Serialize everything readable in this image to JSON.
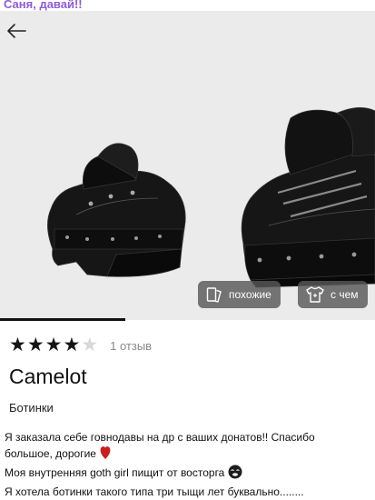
{
  "caption": "Саня, давай!!",
  "icons": {
    "back": "arrow-left-icon",
    "similar": "cards-icon",
    "with": "shirt-icon",
    "heart": "red-heart-emoji",
    "face": "kiss-face-emoji"
  },
  "product": {
    "rating_value": 4,
    "rating_max": 5,
    "reviews_label": "1 отзыв",
    "title": "Camelot",
    "category": "Ботинки"
  },
  "image_actions": {
    "similar_label": "похожие",
    "with_label": "с чем"
  },
  "gallery": {
    "current": 1,
    "total": 3
  },
  "message": {
    "line1": "Я заказала себе говнодавы на др с ваших донатов!! Спасибо",
    "line2": "большое, дорогие",
    "line3": "Моя внутренняя goth girl пищит от восторга",
    "line4": "Я хотела ботинки такого типа три тыщи лет буквально........"
  },
  "colors": {
    "caption": "#8e5bd8",
    "chip_bg": "#585858",
    "photo_bg": "#ebebeb",
    "star_on": "#151515",
    "star_off": "#d8d8d8"
  }
}
